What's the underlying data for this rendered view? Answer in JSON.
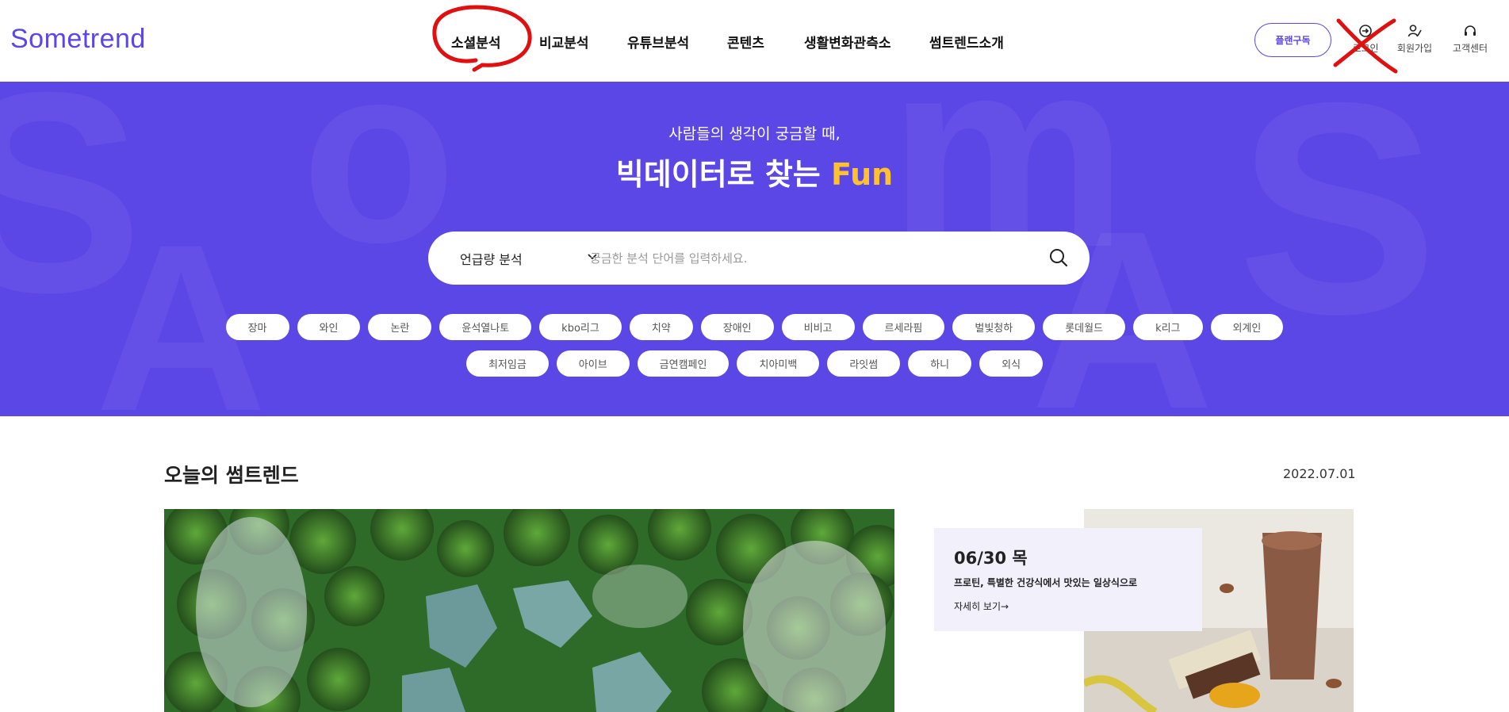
{
  "brand": {
    "logo": "Sometrend",
    "color": "#5b46e6",
    "accent": "#ffc12e"
  },
  "nav": {
    "items": [
      {
        "label": "소셜분석"
      },
      {
        "label": "비교분석"
      },
      {
        "label": "유튜브분석"
      },
      {
        "label": "콘텐츠"
      },
      {
        "label": "생활변화관측소"
      },
      {
        "label": "썸트렌드소개"
      }
    ]
  },
  "header": {
    "plan_button": "플랜구독",
    "login": "로그인",
    "signup": "회원가입",
    "support": "고객센터"
  },
  "hero": {
    "subtitle": "사람들의 생각이 궁금할 때,",
    "title_main": "빅데이터로 찾는 ",
    "title_accent": "Fun",
    "search": {
      "select_value": "언급량 분석",
      "placeholder": "궁금한 분석 단어를 입력하세요."
    },
    "tags_row1": [
      "장마",
      "와인",
      "논란",
      "윤석열나토",
      "kbo리그",
      "치약",
      "장애인",
      "비비고",
      "르세라핌",
      "벌빛청하",
      "롯데월드",
      "k리그",
      "외계인"
    ],
    "tags_row2": [
      "최저임금",
      "아이브",
      "금연캠페인",
      "치아미백",
      "라잇썸",
      "하니",
      "외식"
    ]
  },
  "today": {
    "title": "오늘의 썸트렌드",
    "date": "2022.07.01",
    "card": {
      "date": "06/30 목",
      "desc": "프로틴, 특별한 건강식에서 맛있는 일상식으로",
      "more": "자세히 보기→"
    }
  },
  "icons": [
    "login-icon",
    "signup-icon",
    "headset-icon",
    "chevron-down-icon",
    "search-icon"
  ]
}
